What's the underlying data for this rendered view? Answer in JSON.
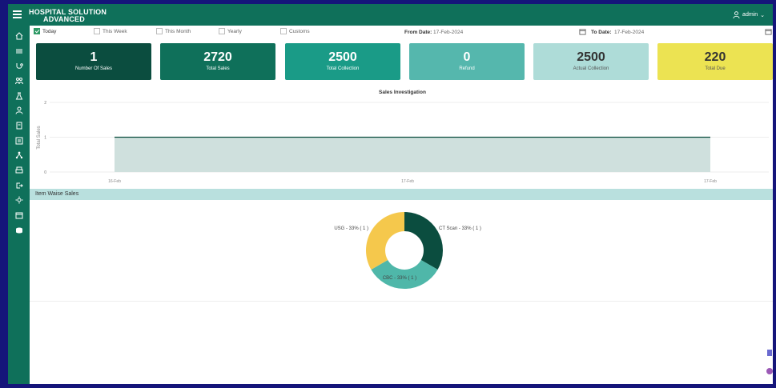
{
  "app": {
    "brand_line1": "HOSPITAL SOLUTION",
    "brand_line2": "ADVANCED",
    "user_name": "admin"
  },
  "sidebar_icons": [
    "home-icon",
    "list-icon",
    "stethoscope-icon",
    "team-icon",
    "lab-icon",
    "person-icon",
    "document-icon",
    "report-icon",
    "hierarchy-icon",
    "print-icon",
    "exit-icon",
    "sun-icon",
    "calendar-icon",
    "database-icon"
  ],
  "filters": {
    "options": [
      {
        "label": "Today",
        "checked": true
      },
      {
        "label": "This Week",
        "checked": false
      },
      {
        "label": "This Month",
        "checked": false
      },
      {
        "label": "Yearly",
        "checked": false
      },
      {
        "label": "Customs",
        "checked": false
      }
    ],
    "from_label": "From Date:",
    "from_value": "17-Feb-2024",
    "to_label": "To Date:",
    "to_value": "17-Feb-2024"
  },
  "cards": [
    {
      "value": "1",
      "label": "Number Of Sales",
      "color": "#0b4d3f"
    },
    {
      "value": "2720",
      "label": "Total Sales",
      "color": "#0f705a"
    },
    {
      "value": "2500",
      "label": "Total Collection",
      "color": "#1a9b87"
    },
    {
      "value": "0",
      "label": "Refund",
      "color": "#55b7ad"
    },
    {
      "value": "2500",
      "label": "Actual Collection",
      "color": "#aedcd8"
    },
    {
      "value": "220",
      "label": "Total Due",
      "color": "#ece352"
    }
  ],
  "chart_data": [
    {
      "type": "area",
      "title": "Sales Investigation",
      "ylabel": "Total Sales",
      "x": [
        "16-Feb",
        "17-Feb",
        "17-Feb"
      ],
      "y_ticks": [
        0,
        1,
        2
      ],
      "ylim": [
        0,
        2
      ],
      "values": [
        1,
        1,
        1
      ],
      "color": "#0b4d3f",
      "fill": "#cfe0dd"
    },
    {
      "type": "pie",
      "title": "Item Waise Sales",
      "slices": [
        {
          "label": "CT Scan - 33% ( 1 )",
          "value": 1,
          "color": "#0b4d3f"
        },
        {
          "label": "CBC - 33% ( 1 )",
          "value": 1,
          "color": "#4fb7a9"
        },
        {
          "label": "USG - 33% ( 1 )",
          "value": 1,
          "color": "#f5c84c"
        }
      ]
    }
  ],
  "section": {
    "item_sales_title": "Item Waise Sales"
  }
}
